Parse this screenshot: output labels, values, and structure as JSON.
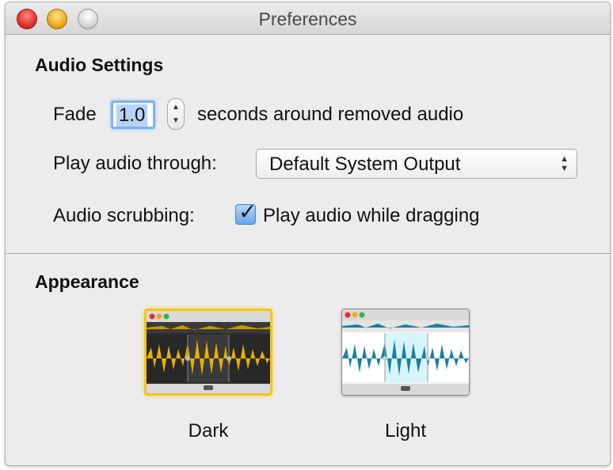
{
  "window": {
    "title": "Preferences"
  },
  "audio": {
    "heading": "Audio Settings",
    "fade_label": "Fade",
    "fade_value": "1.0",
    "fade_suffix": "seconds around removed audio",
    "play_through_label": "Play audio through:",
    "play_through_value": "Default System Output",
    "scrubbing_label": "Audio scrubbing:",
    "scrubbing_checkbox_label": "Play audio while dragging",
    "scrubbing_checked": true
  },
  "appearance": {
    "heading": "Appearance",
    "themes": [
      {
        "label": "Dark",
        "selected": true,
        "accent": "#e8b100"
      },
      {
        "label": "Light",
        "selected": false,
        "accent": "#1a7fa0"
      }
    ]
  },
  "colors": {
    "focus_ring": "#7fb2ef",
    "checkbox_blue": "#6aa6ea",
    "selection_ring": "#f5c518"
  }
}
